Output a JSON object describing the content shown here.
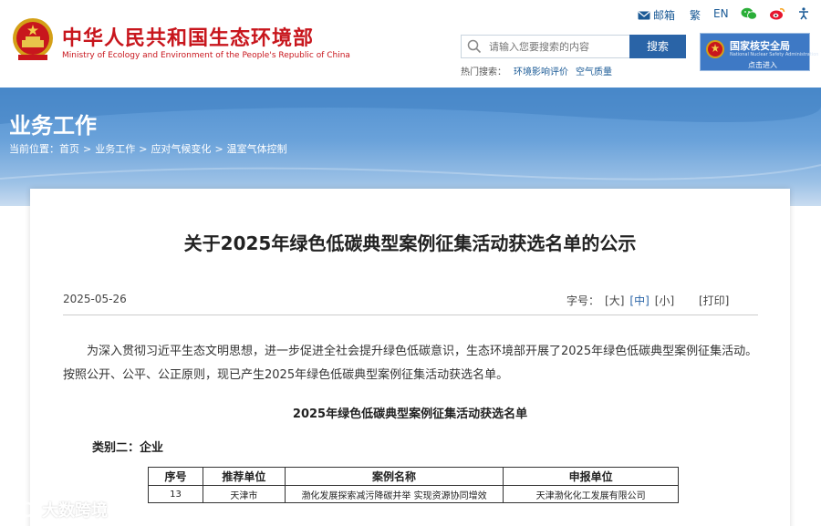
{
  "header": {
    "site_name_cn": "中华人民共和国生态环境部",
    "site_name_en": "Ministry of Ecology and Environment of the People's Republic of China",
    "top_links": {
      "mail": "邮箱",
      "traditional": "繁",
      "english": "EN"
    },
    "search": {
      "placeholder": "请输入您要搜索的内容",
      "button": "搜索",
      "hot_label": "热门搜索：",
      "hot_terms": [
        "环境影响评价",
        "空气质量"
      ]
    },
    "nnsa": {
      "name_cn": "国家核安全局",
      "name_en": "National Nuclear Safety Administration",
      "enter": "点击进入"
    }
  },
  "banner": {
    "section_title": "业务工作",
    "breadcrumb_label": "当前位置：",
    "breadcrumb": [
      "首页",
      "业务工作",
      "应对气候变化",
      "温室气体控制"
    ]
  },
  "article": {
    "title": "关于2025年绿色低碳典型案例征集活动获选名单的公示",
    "date": "2025-05-26",
    "font_size_label": "字号：",
    "font_sizes": [
      "[大]",
      "[中]",
      "[小]"
    ],
    "print": "[打印]",
    "paragraph": "为深入贯彻习近平生态文明思想，进一步促进全社会提升绿色低碳意识，生态环境部开展了2025年绿色低碳典型案例征集活动。按照公开、公平、公正原则，现已产生2025年绿色低碳典型案例征集活动获选名单。",
    "list_title": "2025年绿色低碳典型案例征集活动获选名单",
    "category": "类别二：企业",
    "table": {
      "headers": [
        "序号",
        "推荐单位",
        "案例名称",
        "申报单位"
      ],
      "rows": [
        [
          "13",
          "天津市",
          "渤化发展探索减污降碳并举 实现资源协同增效",
          "天津渤化化工发展有限公司"
        ]
      ]
    }
  },
  "watermark": "大数跨境",
  "colors": {
    "brand_red": "#c8161d",
    "brand_blue": "#2a64a7",
    "banner_blue": "#4f8fd0"
  }
}
